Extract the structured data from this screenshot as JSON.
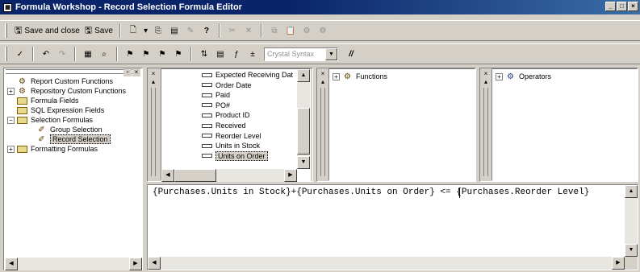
{
  "window": {
    "title": "Formula Workshop - Record Selection Formula Editor"
  },
  "toolbar1": {
    "save_close": "Save and close",
    "save": "Save"
  },
  "toolbar2": {
    "syntax_combo": "Crystal Syntax",
    "comment_label": "//"
  },
  "tree": {
    "items": [
      {
        "label": "Report Custom Functions",
        "depth": 0
      },
      {
        "label": "Repository Custom Functions",
        "depth": 0
      },
      {
        "label": "Formula Fields",
        "depth": 0
      },
      {
        "label": "SQL Expression Fields",
        "depth": 0
      },
      {
        "label": "Selection Formulas",
        "depth": 0
      },
      {
        "label": "Group Selection",
        "depth": 1
      },
      {
        "label": "Record Selection",
        "depth": 1
      },
      {
        "label": "Formatting Formulas",
        "depth": 0
      }
    ]
  },
  "fields": {
    "items": [
      "Expected Receiving Dat",
      "Order Date",
      "Paid",
      "PO#",
      "Product ID",
      "Received",
      "Reorder Level",
      "Units in Stock",
      "Units on Order"
    ]
  },
  "functions": {
    "root": "Functions"
  },
  "operators": {
    "root": "Operators"
  },
  "editor": {
    "text": "{Purchases.Units in Stock}+{Purchases.Units on Order} <= {Purchases.Reorder Level}"
  }
}
